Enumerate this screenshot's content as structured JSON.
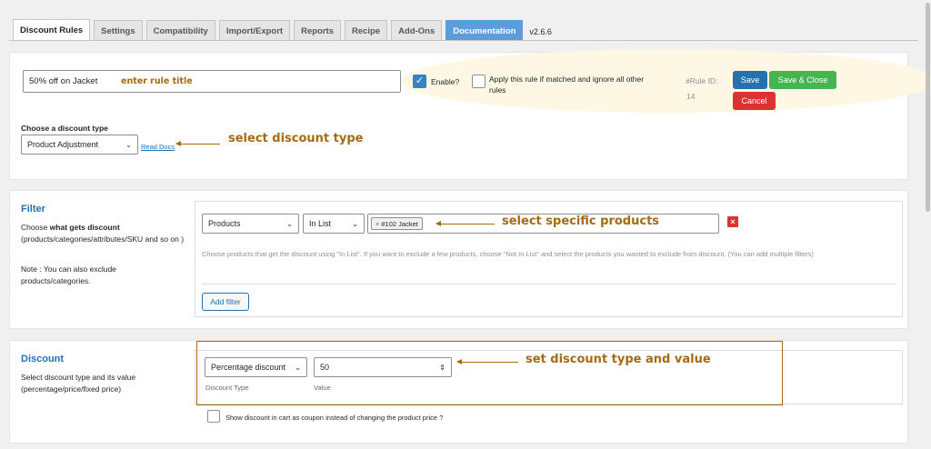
{
  "tabs": [
    {
      "label": "Discount Rules",
      "active": true
    },
    {
      "label": "Settings"
    },
    {
      "label": "Compatibility"
    },
    {
      "label": "Import/Export"
    },
    {
      "label": "Reports"
    },
    {
      "label": "Recipe"
    },
    {
      "label": "Add-Ons"
    },
    {
      "label": "Documentation"
    }
  ],
  "version": "v2.6.6",
  "rule": {
    "title_value": "50% off on Jacket",
    "title_annotation": "enter rule title",
    "enable_label": "Enable?",
    "enable_checked": true,
    "apply_label_line1": "Apply this rule if matched and ignore all other",
    "apply_label_line2": "rules",
    "apply_checked": false,
    "rule_id_label": "#Rule ID:",
    "rule_id_value": "14",
    "save_label": "Save",
    "save_close_label": "Save & Close",
    "cancel_label": "Cancel"
  },
  "discount_type": {
    "label": "Choose a discount type",
    "selected": "Product Adjustment",
    "read_docs": "Read Docs",
    "annotation": "select discount type"
  },
  "filter": {
    "title": "Filter",
    "desc_prefix": "Choose ",
    "desc_bold": "what gets discount",
    "desc_rest": "(products/categories/attributes/SKU and so on )",
    "note": "Note : You can also exclude products/categories.",
    "type_selected": "Products",
    "operator_selected": "In List",
    "tag_label": "#102 Jacket",
    "tag_remove": "×",
    "annotation": "select specific products",
    "help_text": "Choose products that get the discount using \"In List\". If you want to exclude a few products, choose \"Not In List\" and select the products you wanted to exclude from discount. (You can add multiple filters)",
    "add_filter_label": "Add filter",
    "remove_icon": "×"
  },
  "discount": {
    "title": "Discount",
    "desc": "Select discount type and its value (percentage/price/fixed price)",
    "type_selected": "Percentage discount",
    "value": "50",
    "type_caption": "Discount Type",
    "value_caption": "Value",
    "annotation": "set discount type and value",
    "coupon_label": "Show discount in cart as coupon instead of changing the product price ?",
    "coupon_checked": false
  },
  "colors": {
    "primary": "#2271b1",
    "success": "#46b450",
    "danger": "#dc3232",
    "annotation": "#a66a12",
    "documentation_tab": "#5b9dd9"
  }
}
